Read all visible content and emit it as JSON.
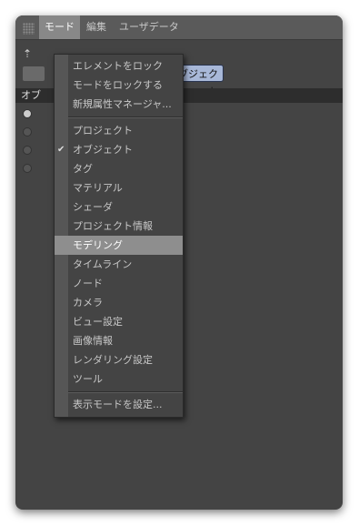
{
  "menubar": {
    "grip_icon": "grip-dots-icon",
    "items": [
      {
        "label": "モード",
        "active": true
      },
      {
        "label": "編集",
        "active": false
      },
      {
        "label": "ユーザデータ",
        "active": false
      }
    ]
  },
  "panel": {
    "chip_label": "オブジェクト",
    "section_label": "オブ"
  },
  "dropdown": {
    "group1": [
      "エレメントをロック",
      "モードをロックする",
      "新規属性マネージャ..."
    ],
    "group2": [
      {
        "label": "プロジェクト",
        "checked": false,
        "highlighted": false
      },
      {
        "label": "オブジェクト",
        "checked": true,
        "highlighted": false
      },
      {
        "label": "タグ",
        "checked": false,
        "highlighted": false
      },
      {
        "label": "マテリアル",
        "checked": false,
        "highlighted": false
      },
      {
        "label": "シェーダ",
        "checked": false,
        "highlighted": false
      },
      {
        "label": "プロジェクト情報",
        "checked": false,
        "highlighted": false
      },
      {
        "label": "モデリング",
        "checked": false,
        "highlighted": true
      },
      {
        "label": "タイムライン",
        "checked": false,
        "highlighted": false
      },
      {
        "label": "ノード",
        "checked": false,
        "highlighted": false
      },
      {
        "label": "カメラ",
        "checked": false,
        "highlighted": false
      },
      {
        "label": "ビュー設定",
        "checked": false,
        "highlighted": false
      },
      {
        "label": "画像情報",
        "checked": false,
        "highlighted": false
      },
      {
        "label": "レンダリング設定",
        "checked": false,
        "highlighted": false
      },
      {
        "label": "ツール",
        "checked": false,
        "highlighted": false
      }
    ],
    "group3": [
      "表示モードを設定..."
    ],
    "check_glyph": "✔"
  },
  "colors": {
    "window_bg": "#444444",
    "menubar_bg": "#5a5a5a",
    "active_menu_bg": "#888888",
    "highlight_bg": "#8e8e8e",
    "chip_bg": "#a8b8d8"
  }
}
